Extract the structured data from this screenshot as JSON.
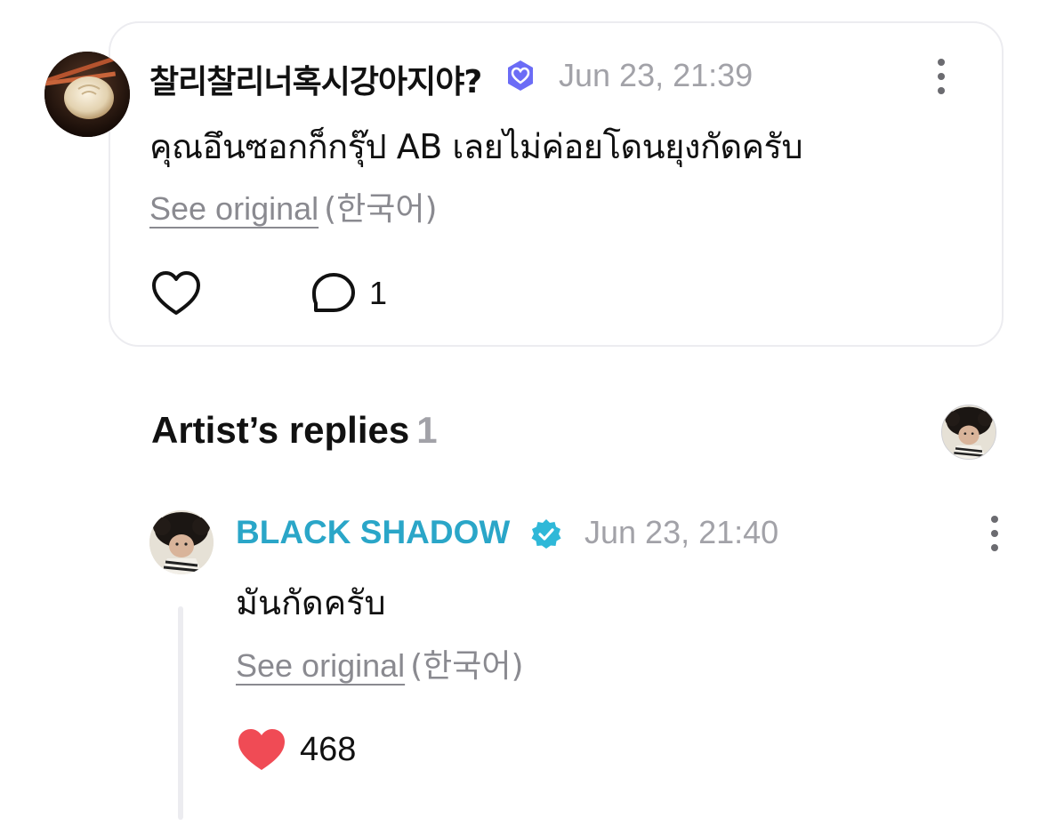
{
  "comment": {
    "username": "찰리찰리너혹시강아지야?",
    "timestamp": "Jun 23, 21:39",
    "text": "คุณอึนซอกก็กรุ๊ป AB เลยไม่ค่อยโดนยุงกัดครับ",
    "see_original": "See original",
    "language": "(한국어)",
    "reply_count": "1"
  },
  "artist_replies": {
    "title": "Artist’s replies",
    "count": "1"
  },
  "reply": {
    "username": "BLACK SHADOW",
    "timestamp": "Jun 23, 21:40",
    "text": "มันกัดครับ",
    "see_original": "See original",
    "language": "(한국어)",
    "like_count": "468"
  },
  "colors": {
    "artist_name": "#2aa6c8",
    "timestamp": "#a2a2a8",
    "like_red": "#f04b55",
    "user_badge": "#6b6cf6",
    "artist_badge": "#2fb8d8"
  }
}
